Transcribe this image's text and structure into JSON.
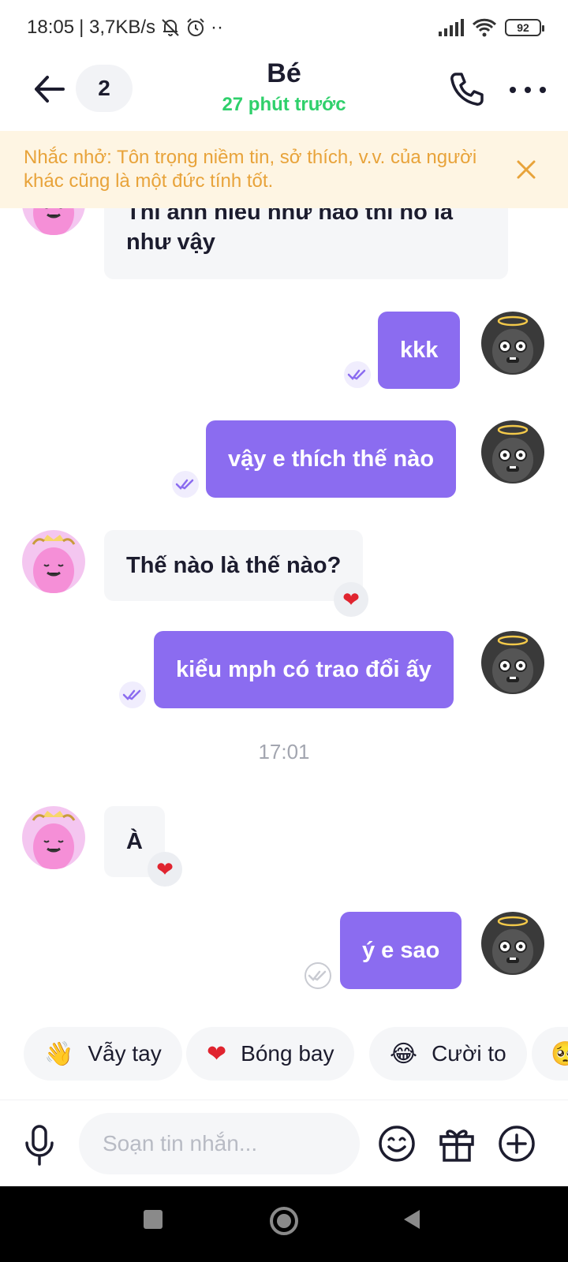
{
  "status_bar": {
    "time": "18:05",
    "speed": "| 3,7KB/s",
    "dots": "··",
    "battery": "92"
  },
  "header": {
    "unread_count": "2",
    "title": "Bé",
    "subtitle": "27 phút trước"
  },
  "reminder": {
    "text": "Nhắc nhở: Tôn trọng niềm tin, sở thích, v.v. của người khác cũng là một đức tính tốt."
  },
  "messages": [
    {
      "side": "in",
      "text": "Thì anh hiểu như nào thì nó là như vậy"
    },
    {
      "side": "out",
      "text": "kkk",
      "read": true
    },
    {
      "side": "out",
      "text": "vậy e thích thế nào",
      "read": true
    },
    {
      "side": "in",
      "text": "Thế nào là thế nào?",
      "reaction": "heart"
    },
    {
      "side": "out",
      "text": "kiểu mph có trao đổi ấy",
      "read": true
    },
    {
      "side": "in",
      "text": "À",
      "reaction": "heart"
    },
    {
      "side": "out",
      "text": "ý e sao",
      "read": false
    }
  ],
  "time_separator": "17:01",
  "quick_replies": [
    {
      "emoji": "👋",
      "label": "Vẫy tay"
    },
    {
      "emoji": "❤",
      "label": "Bóng bay"
    },
    {
      "emoji": "😂",
      "label": "Cười to"
    },
    {
      "emoji": "🥺",
      "label": ""
    }
  ],
  "composer": {
    "placeholder": "Soạn tin nhắn..."
  },
  "colors": {
    "accent": "#8b6cf0",
    "online": "#2fd06b",
    "reminder_bg": "#fef5e3",
    "reminder_text": "#e8a33a",
    "heart": "#e0242f"
  }
}
